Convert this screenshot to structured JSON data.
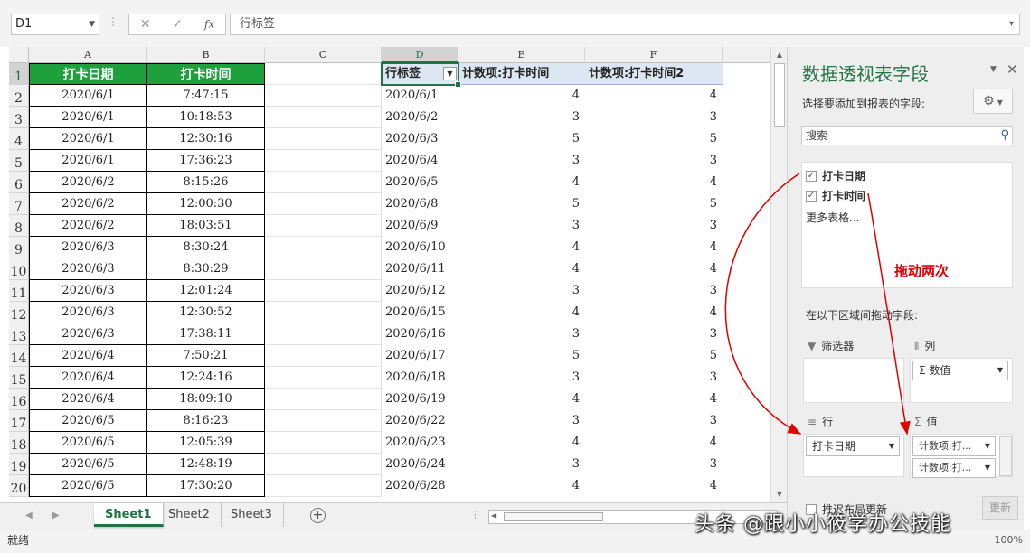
{
  "formula_bar": {
    "name_box": "D1",
    "cancel_glyph": "✕",
    "enter_glyph": "✓",
    "fx_label": "fx",
    "content": "行标签"
  },
  "columns": [
    "A",
    "B",
    "C",
    "D",
    "E",
    "F"
  ],
  "rows": [
    "1",
    "2",
    "3",
    "4",
    "5",
    "6",
    "7",
    "8",
    "9",
    "10",
    "11",
    "12",
    "13",
    "14",
    "15",
    "16",
    "17",
    "18",
    "19",
    "20"
  ],
  "source_table": {
    "headers": [
      "打卡日期",
      "打卡时间"
    ],
    "rows": [
      [
        "2020/6/1",
        "7:47:15"
      ],
      [
        "2020/6/1",
        "10:18:53"
      ],
      [
        "2020/6/1",
        "12:30:16"
      ],
      [
        "2020/6/1",
        "17:36:23"
      ],
      [
        "2020/6/2",
        "8:15:26"
      ],
      [
        "2020/6/2",
        "12:00:30"
      ],
      [
        "2020/6/2",
        "18:03:51"
      ],
      [
        "2020/6/3",
        "8:30:24"
      ],
      [
        "2020/6/3",
        "8:30:29"
      ],
      [
        "2020/6/3",
        "12:01:24"
      ],
      [
        "2020/6/3",
        "12:30:52"
      ],
      [
        "2020/6/3",
        "17:38:11"
      ],
      [
        "2020/6/4",
        "7:50:21"
      ],
      [
        "2020/6/4",
        "12:24:16"
      ],
      [
        "2020/6/4",
        "18:09:10"
      ],
      [
        "2020/6/5",
        "8:16:23"
      ],
      [
        "2020/6/5",
        "12:05:39"
      ],
      [
        "2020/6/5",
        "12:48:19"
      ],
      [
        "2020/6/5",
        "17:30:20"
      ]
    ]
  },
  "pivot_table": {
    "headers": [
      "行标签",
      "计数项:打卡时间",
      "计数项:打卡时间2"
    ],
    "rows": [
      [
        "2020/6/1",
        "4",
        "4"
      ],
      [
        "2020/6/2",
        "3",
        "3"
      ],
      [
        "2020/6/3",
        "5",
        "5"
      ],
      [
        "2020/6/4",
        "3",
        "3"
      ],
      [
        "2020/6/5",
        "4",
        "4"
      ],
      [
        "2020/6/8",
        "5",
        "5"
      ],
      [
        "2020/6/9",
        "3",
        "3"
      ],
      [
        "2020/6/10",
        "4",
        "4"
      ],
      [
        "2020/6/11",
        "4",
        "4"
      ],
      [
        "2020/6/12",
        "3",
        "3"
      ],
      [
        "2020/6/15",
        "4",
        "4"
      ],
      [
        "2020/6/16",
        "3",
        "3"
      ],
      [
        "2020/6/17",
        "5",
        "5"
      ],
      [
        "2020/6/18",
        "3",
        "3"
      ],
      [
        "2020/6/19",
        "4",
        "4"
      ],
      [
        "2020/6/22",
        "3",
        "3"
      ],
      [
        "2020/6/23",
        "4",
        "4"
      ],
      [
        "2020/6/24",
        "3",
        "3"
      ],
      [
        "2020/6/28",
        "4",
        "4"
      ]
    ]
  },
  "sheet_tabs": [
    "Sheet1",
    "Sheet2",
    "Sheet3"
  ],
  "status_bar": {
    "ready": "就绪",
    "zoom": "100%"
  },
  "pivot_pane": {
    "title": "数据透视表字段",
    "choose_fields": "选择要添加到报表的字段:",
    "search_placeholder": "搜索",
    "fields": [
      {
        "label": "打卡日期",
        "checked": true
      },
      {
        "label": "打卡时间",
        "checked": true
      }
    ],
    "more_tables": "更多表格...",
    "drag_between": "在以下区域间拖动字段:",
    "areas": {
      "filters": "筛选器",
      "columns": "列",
      "rows": "行",
      "values": "值"
    },
    "columns_chip": "Σ 数值",
    "rows_chip": "打卡日期",
    "values_chips": [
      "计数项:打...",
      "计数项:打..."
    ],
    "defer_update": "推迟布局更新",
    "update_button": "更新"
  },
  "annotation": "拖动两次",
  "watermark": "头条 @跟小小筱学办公技能",
  "colors": {
    "accent": "#217346",
    "header_green": "#1ea03c",
    "annotation_red": "#e00000"
  },
  "icons": [
    "gear-icon",
    "search-icon",
    "close-icon",
    "funnel-icon",
    "columns-icon",
    "rows-icon",
    "sigma-icon"
  ]
}
